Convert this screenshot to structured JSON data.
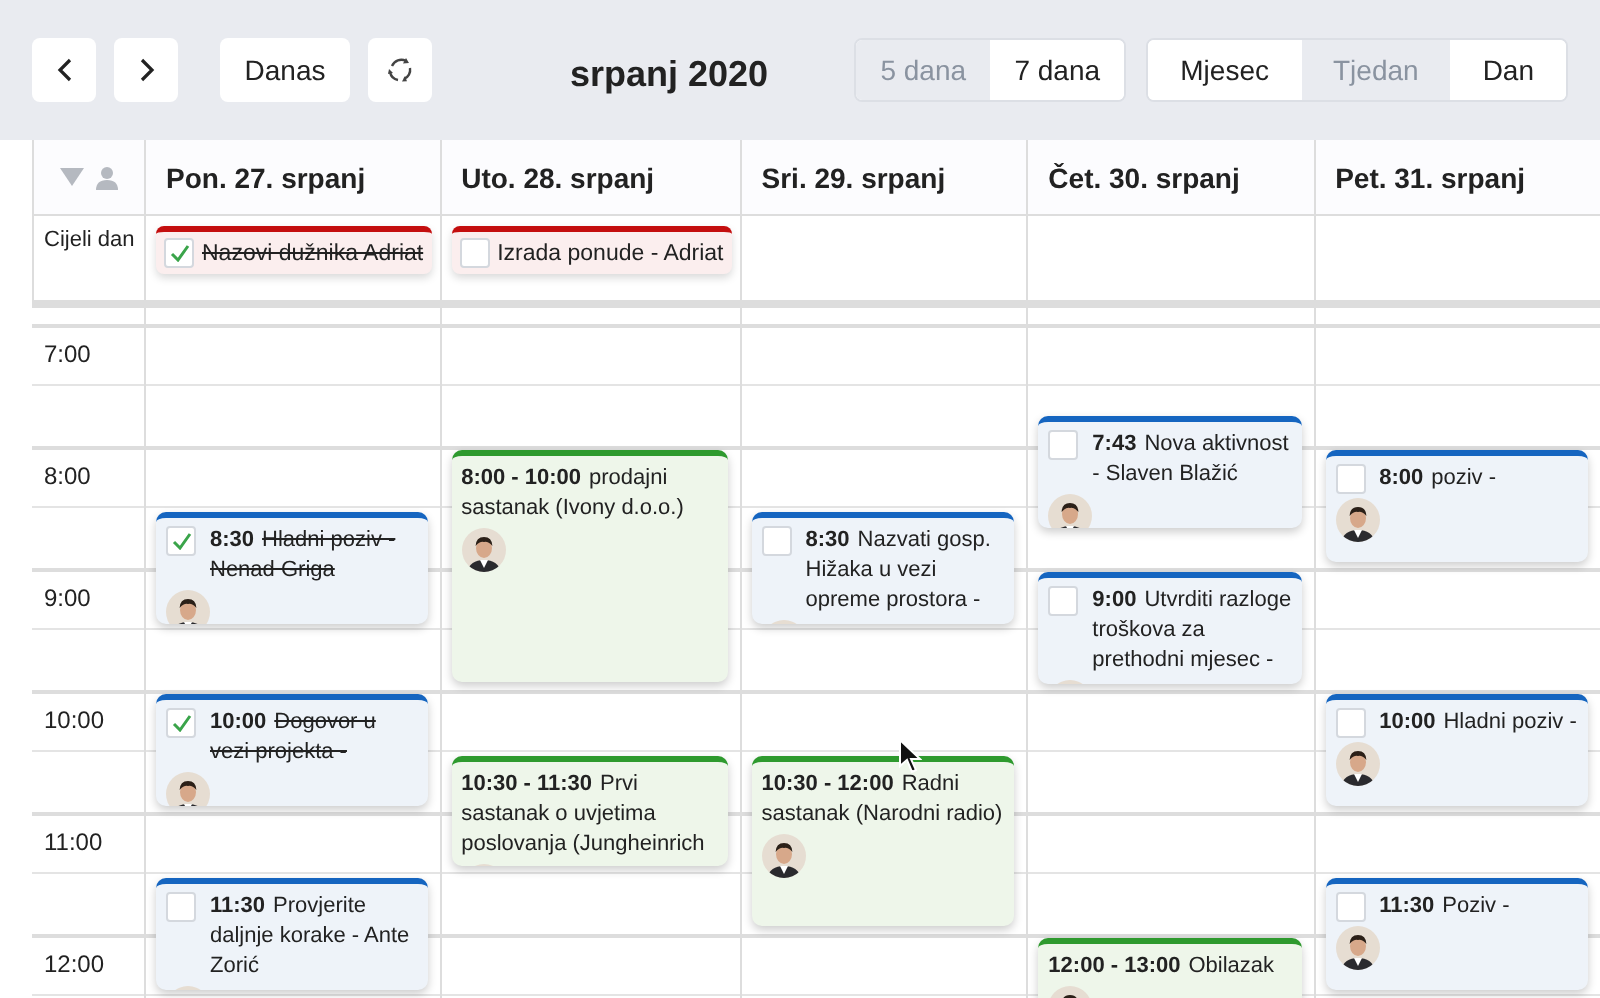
{
  "toolbar": {
    "today": "Danas",
    "title": "srpanj 2020",
    "range_options": [
      {
        "label": "5 dana",
        "selected": true
      },
      {
        "label": "7 dana",
        "selected": false
      }
    ],
    "view_options": [
      {
        "label": "Mjesec",
        "selected": false
      },
      {
        "label": "Tjedan",
        "selected": true
      },
      {
        "label": "Dan",
        "selected": false
      }
    ]
  },
  "calendar": {
    "all_day_label": "Cijeli dan",
    "hours": [
      "7:00",
      "8:00",
      "9:00",
      "10:00",
      "11:00",
      "12:00"
    ],
    "days": [
      {
        "label": "Pon. 27. srpanj",
        "all_day": [
          {
            "title": "Nazovi dužnika Adriat",
            "checked": true
          }
        ],
        "events": [
          {
            "kind": "task",
            "time": "8:30",
            "title": "Hladni poziv - Nenad Griga",
            "checked": true
          },
          {
            "kind": "task",
            "time": "10:00",
            "title": "Dogovor u vezi projekta -",
            "checked": true
          },
          {
            "kind": "task",
            "time": "11:30",
            "title": "Provjerite daljnje korake - Ante Zorić",
            "checked": false
          }
        ]
      },
      {
        "label": "Uto. 28. srpanj",
        "all_day": [
          {
            "title": "Izrada ponude - Adriat",
            "checked": false
          }
        ],
        "events": [
          {
            "kind": "meeting",
            "time": "8:00 - 10:00",
            "title": "prodajni sastanak (Ivony d.o.o.)"
          },
          {
            "kind": "meeting",
            "time": "10:30 - 11:30",
            "title": "Prvi sastanak o uvjetima poslovanja (Jungheinrich"
          }
        ]
      },
      {
        "label": "Sri. 29. srpanj",
        "events": [
          {
            "kind": "task",
            "time": "8:30",
            "title": "Nazvati gosp. Hižaka u vezi opreme prostora -",
            "checked": false
          },
          {
            "kind": "meeting",
            "time": "10:30 - 12:00",
            "title": "Radni sastanak (Narodni radio)"
          }
        ]
      },
      {
        "label": "Čet. 30. srpanj",
        "events": [
          {
            "kind": "task",
            "time": "7:43",
            "title": "Nova aktivnost - Slaven Blažić",
            "checked": false
          },
          {
            "kind": "task",
            "time": "9:00",
            "title": "Utvrditi razloge troškova za prethodni mjesec -",
            "checked": false
          },
          {
            "kind": "meeting",
            "time": "12:00 - 13:00",
            "title": "Obilazak"
          }
        ]
      },
      {
        "label": "Pet. 31. srpanj",
        "events": [
          {
            "kind": "task",
            "time": "8:00",
            "title": "poziv -",
            "checked": false
          },
          {
            "kind": "task",
            "time": "10:00",
            "title": "Hladni poziv -",
            "checked": false
          },
          {
            "kind": "task",
            "time": "11:30",
            "title": "Poziv -",
            "checked": false
          }
        ]
      }
    ]
  }
}
